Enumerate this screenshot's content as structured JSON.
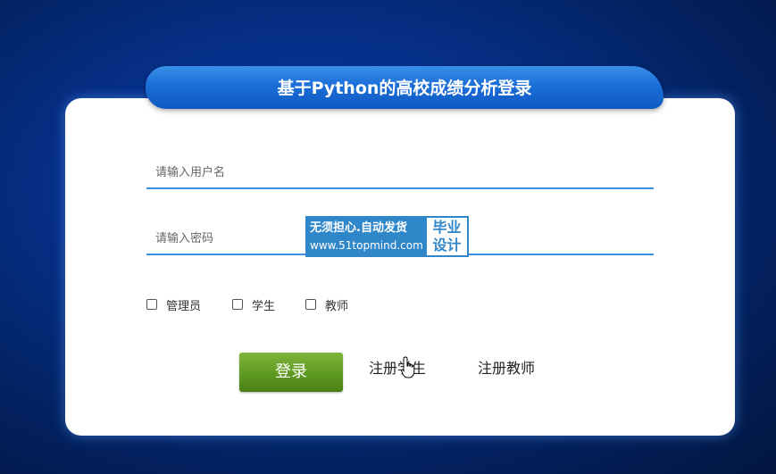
{
  "page": {
    "title": "基于Python的高校成绩分析登录"
  },
  "form": {
    "username_placeholder": "请输入用户名",
    "password_placeholder": "请输入密码",
    "roles": [
      {
        "label": "管理员",
        "checked": false
      },
      {
        "label": "学生",
        "checked": false
      },
      {
        "label": "教师",
        "checked": false
      }
    ],
    "login_label": "登录",
    "register_student_label": "注册学生",
    "register_teacher_label": "注册教师"
  },
  "watermark": {
    "line1": "无须担心.自动发货",
    "line2": "www.51topmind.com",
    "badge_top": "毕业",
    "badge_bottom": "设计"
  },
  "colors": {
    "background": "#06308a",
    "title_tab": "#1b6ed8",
    "field_underline": "#3b8fe0",
    "login_button": "#5e9a22"
  },
  "icons": {
    "cursor": "hand-pointer-icon"
  }
}
